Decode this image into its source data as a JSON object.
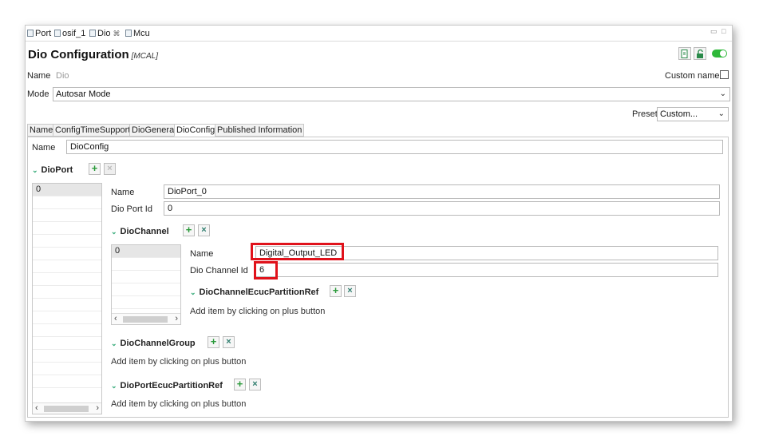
{
  "tabs": [
    {
      "label": "Port",
      "active": false
    },
    {
      "label": "osif_1",
      "active": false
    },
    {
      "label": "Dio",
      "active": true,
      "close": "⌘"
    },
    {
      "label": "Mcu",
      "active": false
    }
  ],
  "window_controls": {
    "minimize": "▭",
    "maximize": "□"
  },
  "header": {
    "title": "Dio Configuration",
    "subtitle": "[MCAL]"
  },
  "top_fields": {
    "name_label": "Name",
    "name_value": "Dio",
    "custom_name_label": "Custom name",
    "mode_label": "Mode",
    "mode_value": "Autosar Mode",
    "preset_label": "Preset",
    "preset_value": "Custom..."
  },
  "subtabs": [
    "Name",
    "ConfigTimeSupport",
    "DioGeneral",
    "DioConfig",
    "Published Information"
  ],
  "dio_config": {
    "name_label": "Name",
    "name_value": "DioConfig"
  },
  "dio_port": {
    "section": "DioPort",
    "items": [
      "0"
    ],
    "name_label": "Name",
    "name_value": "DioPort_0",
    "id_label": "Dio Port Id",
    "id_value": "0"
  },
  "dio_channel": {
    "section": "DioChannel",
    "items": [
      "0"
    ],
    "name_label": "Name",
    "name_value": "Digital_Output_LED",
    "id_label": "Dio Channel Id",
    "id_value": "6"
  },
  "partition_ref": {
    "section": "DioChannelEcucPartitionRef",
    "hint": "Add item by clicking on plus button"
  },
  "channel_group": {
    "section": "DioChannelGroup",
    "hint": "Add item by clicking on plus button"
  },
  "port_partition_ref": {
    "section": "DioPortEcucPartitionRef",
    "hint": "Add item by clicking on plus button"
  },
  "icons": {
    "plus": "+",
    "remove": "×",
    "caret": "⌄",
    "chevron": "⌄",
    "scroll_left": "‹",
    "scroll_right": "›"
  },
  "colors": {
    "toggle_on": "#2fb83a",
    "highlight": "#e0121b",
    "plus": "#2a9a3a"
  }
}
